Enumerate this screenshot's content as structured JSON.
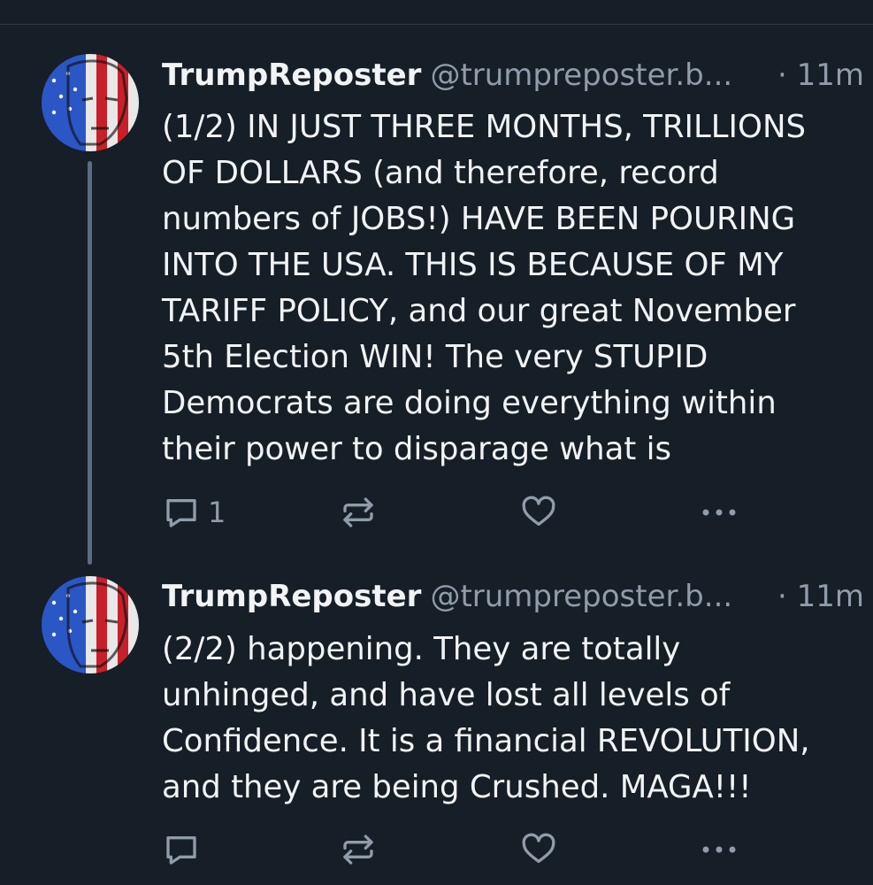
{
  "posts": [
    {
      "display_name": "TrumpReposter",
      "handle": "@trumpreposter.b...",
      "timestamp": "· 11m",
      "text": "(1/2) IN JUST THREE MONTHS, TRILLIONS\nOF DOLLARS (and therefore, record\nnumbers of JOBS!) HAVE BEEN POURING\nINTO THE USA. THIS IS BECAUSE OF MY\nTARIFF POLICY, and our great November\n5th Election WIN! The very STUPID\nDemocrats are doing everything within\ntheir power to disparage what is",
      "reply_count": "1",
      "icons": [
        "reply-icon",
        "repost-icon",
        "like-icon",
        "more-icon"
      ]
    },
    {
      "display_name": "TrumpReposter",
      "handle": "@trumpreposter.b...",
      "timestamp": "· 11m",
      "text": "(2/2) happening. They are totally\nunhinged, and have lost all levels of\nConfidence. It is a financial REVOLUTION,\nand they are being Crushed. MAGA!!!",
      "reply_count": "",
      "icons": [
        "reply-icon",
        "repost-icon",
        "like-icon",
        "more-icon"
      ]
    }
  ],
  "colors": {
    "background": "#161e27",
    "text": "#f1f3f5",
    "muted": "#8f9cab",
    "thread_line": "#5a6c83"
  }
}
